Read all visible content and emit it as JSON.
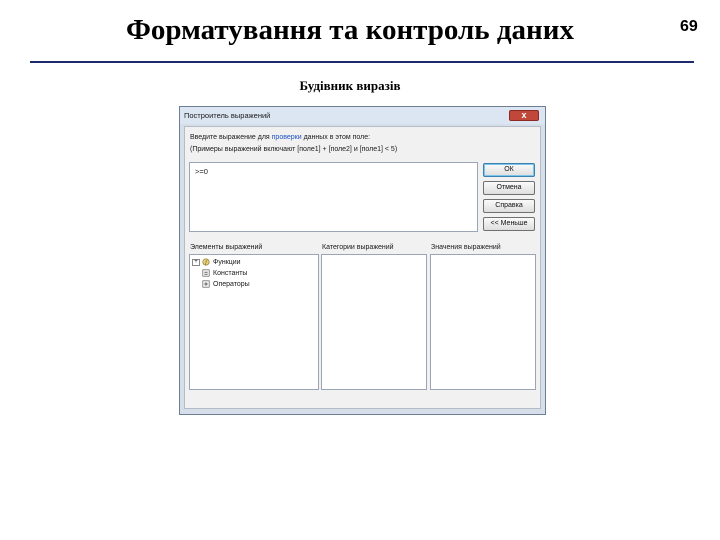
{
  "slide": {
    "title": "Форматування та контроль даних",
    "page_number": "69",
    "caption": "Будівник виразів"
  },
  "dialog": {
    "title": "Построитель выражений",
    "close_glyph": "x",
    "prompt_before": "Введите выражение для ",
    "prompt_link": "проверки",
    "prompt_after": " данных в этом поле:",
    "hint": "(Примеры выражений включают [поле1] + [поле2] и [поле1] < 5)",
    "expression": ">=0",
    "buttons": {
      "ok": "ОК",
      "cancel": "Отмена",
      "help": "Справка",
      "less": "<< Меньше"
    },
    "columns": {
      "elements": "Элементы выражений",
      "categories": "Категории выражений",
      "values": "Значения выражений"
    },
    "tree": [
      {
        "label": "Функции",
        "expander": "+",
        "icon": "functions-icon"
      },
      {
        "label": "Константы",
        "expander": "",
        "icon": "constants-icon"
      },
      {
        "label": "Операторы",
        "expander": "",
        "icon": "operators-icon"
      }
    ]
  }
}
